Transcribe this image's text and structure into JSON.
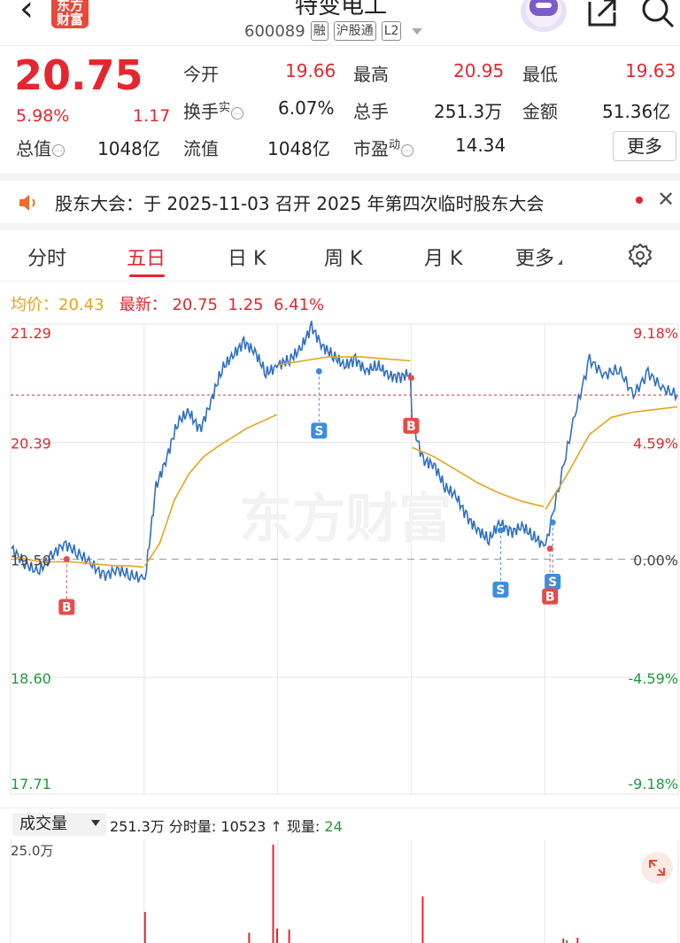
{
  "header": {
    "logo_top": "东方",
    "logo_bottom": "财富",
    "stock_name": "特变电工",
    "stock_code": "600089",
    "tags": [
      "融",
      "沪股通",
      "L2"
    ]
  },
  "quote": {
    "price": "20.75",
    "change_pct": "5.98%",
    "change": "1.17",
    "open_label": "今开",
    "open": "19.66",
    "high_label": "最高",
    "high": "20.95",
    "low_label": "最低",
    "low": "19.63",
    "turnover_label": "换手",
    "turnover_sup": "实",
    "turnover": "6.07%",
    "volume_label": "总手",
    "volume": "251.3万",
    "amount_label": "金额",
    "amount": "51.36亿",
    "mcap_label": "总值",
    "mcap": "1048亿",
    "float_label": "流值",
    "float_cap": "1048亿",
    "pe_label": "市盈",
    "pe_sup": "动",
    "pe": "14.34",
    "more_button": "更多"
  },
  "notice": {
    "text": "股东大会：于 2025-11-03 召开 2025 年第四次临时股东大会"
  },
  "tabs": [
    {
      "label": "分时",
      "active": false
    },
    {
      "label": "五日",
      "active": true
    },
    {
      "label": "日 K",
      "active": false
    },
    {
      "label": "周 K",
      "active": false
    },
    {
      "label": "月 K",
      "active": false
    },
    {
      "label": "更多",
      "active": false
    }
  ],
  "legend": {
    "avg_label": "均价：",
    "avg_value": "20.43",
    "last_label": "最新：",
    "last_value": "20.75",
    "last_change": "1.25",
    "last_pct": "6.41%"
  },
  "chart_data": {
    "type": "line",
    "y_left_ticks": [
      "21.29",
      "20.39",
      "19.50",
      "18.60",
      "17.71"
    ],
    "y_right_ticks": [
      "9.18%",
      "4.59%",
      "0.00%",
      "-4.59%",
      "-9.18%"
    ],
    "ylim": [
      17.71,
      21.29
    ],
    "prev_close": 19.5,
    "days": 5,
    "series": [
      {
        "name": "价格",
        "color": "#2f6fc4",
        "days": [
          [
            19.58,
            19.47,
            19.4,
            19.52,
            19.62,
            19.55,
            19.47,
            19.37,
            19.42,
            19.38,
            19.35
          ],
          [
            19.35,
            20.05,
            20.28,
            20.55,
            20.62,
            20.48,
            20.7,
            20.95,
            21.05,
            21.15,
            21.08,
            20.92,
            20.96
          ],
          [
            20.98,
            21.02,
            21.1,
            21.27,
            21.12,
            21.05,
            20.97,
            21.02,
            20.93,
            20.98,
            20.9,
            20.88,
            20.92
          ],
          [
            20.55,
            20.25,
            20.22,
            20.05,
            19.98,
            19.82,
            19.72,
            19.65,
            19.78,
            19.7,
            19.75,
            19.68,
            19.6
          ],
          [
            19.6,
            20.1,
            20.6,
            21.02,
            20.9,
            20.95,
            20.75,
            20.92,
            20.8,
            20.75
          ]
        ]
      },
      {
        "name": "均价",
        "color": "#e8a317",
        "days": [
          [
            19.52,
            19.5,
            19.48,
            19.48,
            19.48,
            19.47,
            19.46,
            19.45,
            19.45,
            19.44
          ],
          [
            19.45,
            19.62,
            19.95,
            20.15,
            20.28,
            20.36,
            20.43,
            20.5,
            20.55,
            20.6
          ],
          [
            20.98,
            21.0,
            21.02,
            21.04,
            21.04,
            21.04,
            21.03,
            21.02,
            21.01
          ],
          [
            20.35,
            20.28,
            20.18,
            20.08,
            20.0,
            19.94,
            19.9
          ],
          [
            19.88,
            20.15,
            20.45,
            20.58,
            20.62,
            20.64,
            20.66
          ]
        ]
      }
    ],
    "markers": [
      {
        "day": 1,
        "type": "B",
        "price": 19.5
      },
      {
        "day": 3,
        "type": "S",
        "price": 20.93
      },
      {
        "day": 3,
        "type": "B",
        "price": 20.88
      },
      {
        "day": 4,
        "type": "S",
        "price": 19.72
      },
      {
        "day": 5,
        "type": "S",
        "price": 19.78
      },
      {
        "day": 5,
        "type": "B",
        "price": 19.58
      }
    ],
    "watermark": "东方财富"
  },
  "volume": {
    "selector": "成交量",
    "total": "251.3万",
    "tick_vol_label": "分时量:",
    "tick_vol": "10523",
    "now_label": "现量:",
    "now": "24",
    "y_label": "25.0万",
    "bars": [
      {
        "day": 1,
        "frac": 0.92,
        "h": 0.3
      },
      {
        "day": 2,
        "frac": 0.7,
        "h": 0.1
      },
      {
        "day": 2,
        "frac": 0.88,
        "h": 0.95
      },
      {
        "day": 2,
        "frac": 0.91,
        "h": 0.14
      },
      {
        "day": 3,
        "frac": 0.0,
        "h": 0.13
      },
      {
        "day": 4,
        "frac": 0.0,
        "h": 0.45
      },
      {
        "day": 5,
        "frac": 0.16,
        "h": 0.05
      }
    ]
  }
}
